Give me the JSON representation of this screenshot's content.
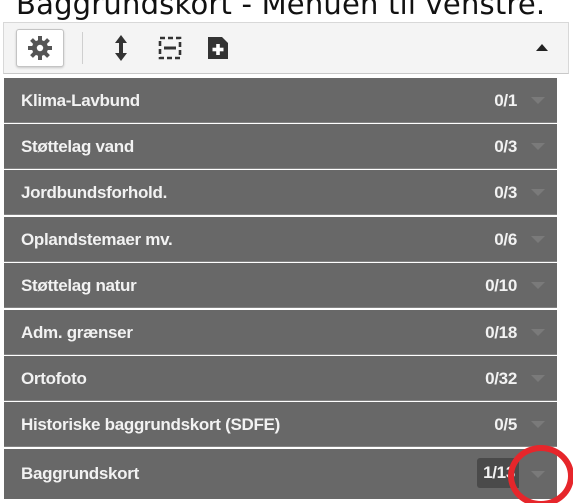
{
  "caption": "Baggrundskort - Menuen til venstre.",
  "toolbar": {
    "icons": [
      "settings-gear-icon",
      "expand-vertical-icon",
      "collapse-icon",
      "add-plus-icon",
      "chevron-up-icon"
    ]
  },
  "layers": [
    {
      "label": "Klima-Lavbund",
      "count": "0/1"
    },
    {
      "label": "Støttelag vand",
      "count": "0/3"
    },
    {
      "label": "Jordbundsforhold.",
      "count": "0/3"
    },
    {
      "label": "Oplandstemaer mv.",
      "count": "0/6"
    },
    {
      "label": "Støttelag natur",
      "count": "0/10"
    },
    {
      "label": "Adm. grænser",
      "count": "0/18"
    },
    {
      "label": "Ortofoto",
      "count": "0/32"
    },
    {
      "label": "Historiske baggrundskort (SDFE)",
      "count": "0/5"
    },
    {
      "label": "Baggrundskort",
      "count": "1/13"
    }
  ],
  "colors": {
    "row_background": "#686868",
    "row_text": "#f2f2f2",
    "toolbar_background": "#f4f4f4",
    "highlight_ring": "#e6262b"
  }
}
